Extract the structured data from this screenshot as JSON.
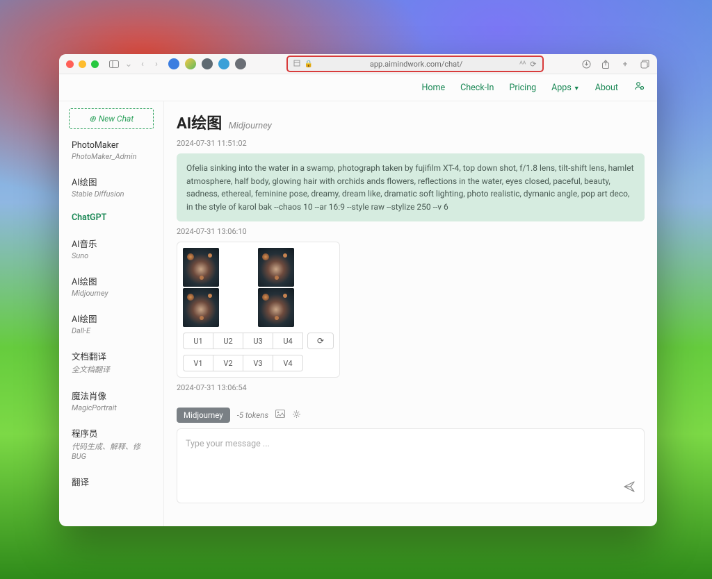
{
  "browser": {
    "url": "app.aimindwork.com/chat/"
  },
  "appnav": {
    "home": "Home",
    "checkin": "Check-In",
    "pricing": "Pricing",
    "apps": "Apps",
    "about": "About"
  },
  "sidebar": {
    "newchat_label": "New Chat",
    "items": [
      {
        "title": "PhotoMaker",
        "subtitle": "PhotoMaker_Admin"
      },
      {
        "title": "AI绘图",
        "subtitle": "Stable Diffusion"
      },
      {
        "title": "ChatGPT",
        "subtitle": ""
      },
      {
        "title": "AI音乐",
        "subtitle": "Suno"
      },
      {
        "title": "AI绘图",
        "subtitle": "Midjourney"
      },
      {
        "title": "AI绘图",
        "subtitle": "Dall-E"
      },
      {
        "title": "文档翻译",
        "subtitle": "全文档翻译"
      },
      {
        "title": "魔法肖像",
        "subtitle": "MagicPortrait"
      },
      {
        "title": "程序员",
        "subtitle": "代码生成、解释、修BUG"
      },
      {
        "title": "翻译",
        "subtitle": ""
      }
    ],
    "active_index": 2
  },
  "page": {
    "title": "AI绘图",
    "subtitle": "Midjourney"
  },
  "messages": {
    "ts1": "2024-07-31 11:51:02",
    "prompt": "Ofelia sinking into the water in a swamp, photograph taken by fujifilm XT-4, top down shot, f/1.8 lens, tilt-shift lens, hamlet atmosphere, half body, glowing hair with orchids ands flowers, reflections in the water, eyes closed, paceful, beauty, sadness, ethereal, feminine pose, dreamy, dream like, dramatic soft lighting, photo realistic, dymanic angle, pop art deco, in the style of karol bak --chaos 10 --ar 16:9 --style raw --stylize 250 --v 6",
    "ts2": "2024-07-31 13:06:10",
    "ts3": "2024-07-31 13:06:54",
    "buttons_u": [
      "U1",
      "U2",
      "U3",
      "U4"
    ],
    "buttons_v": [
      "V1",
      "V2",
      "V3",
      "V4"
    ]
  },
  "composer": {
    "badge": "Midjourney",
    "tokens": "-5 tokens",
    "placeholder": "Type your message ..."
  }
}
